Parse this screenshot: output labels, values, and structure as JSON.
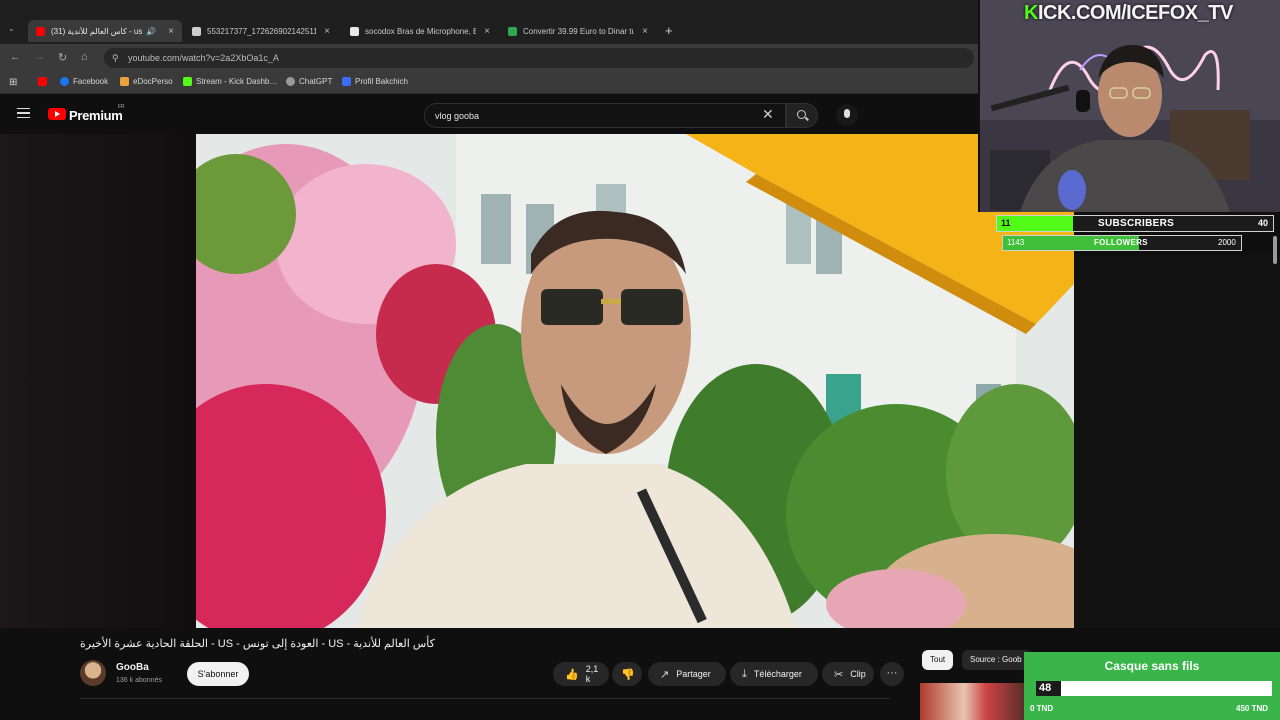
{
  "browser": {
    "tabs": [
      {
        "label": "(31) كأس العالم للأندية - us",
        "active": true,
        "favicon_color": "#ff0000"
      },
      {
        "label": "553217377_172626902142511…",
        "active": false,
        "favicon_color": "#cccccc"
      },
      {
        "label": "socodox Bras de Microphone, B…",
        "active": false,
        "favicon_color": "#e8e8e8"
      },
      {
        "label": "Convertir 39.99 Euro to Dinar tu…",
        "active": false,
        "favicon_color": "#2fa84f"
      }
    ],
    "url": "youtube.com/watch?v=2a2XbOa1c_A",
    "bookmarks": [
      {
        "label": "",
        "color": "#ff0000"
      },
      {
        "label": "Facebook",
        "color": "#1877f2"
      },
      {
        "label": "eDocPerso",
        "color": "#e8a33d"
      },
      {
        "label": "Stream - Kick Dashb…",
        "color": "#53fc18"
      },
      {
        "label": "ChatGPT",
        "color": "#9a9a9a"
      },
      {
        "label": "Profil Bakchich",
        "color": "#3b6ef5"
      }
    ]
  },
  "youtube": {
    "brand": "Premium",
    "brand_sup": "FR",
    "search_query": "vlog gooba",
    "video_title": "الحلقة الحادية عشرة الأخيرة - US - العودة إلى تونس - US - كأس العالم للأندية",
    "channel_name": "GooBa",
    "channel_subs": "136 k abonnés",
    "subscribe_label": "S'abonner",
    "likes": "2,1 k",
    "share_label": "Partager",
    "download_label": "Télécharger",
    "clip_label": "Clip",
    "more_label": "···",
    "chips": [
      "Tout",
      "Source : Goob"
    ]
  },
  "overlay": {
    "kick_prefix": "K",
    "kick_rest": "ICK.COM/ICEFOX_TV",
    "subscribers": {
      "current": "11",
      "label": "SUBSCRIBERS",
      "goal": "40",
      "progress": 0.275
    },
    "followers": {
      "current": "1143",
      "label": "FOLLOWERS",
      "goal": "2000",
      "progress": 0.5715
    },
    "goal_widget": {
      "title": "Casque sans fils",
      "value": "48",
      "min": "0 TND",
      "max": "450 TND",
      "progress": 0.107,
      "color": "#39b54a"
    }
  }
}
